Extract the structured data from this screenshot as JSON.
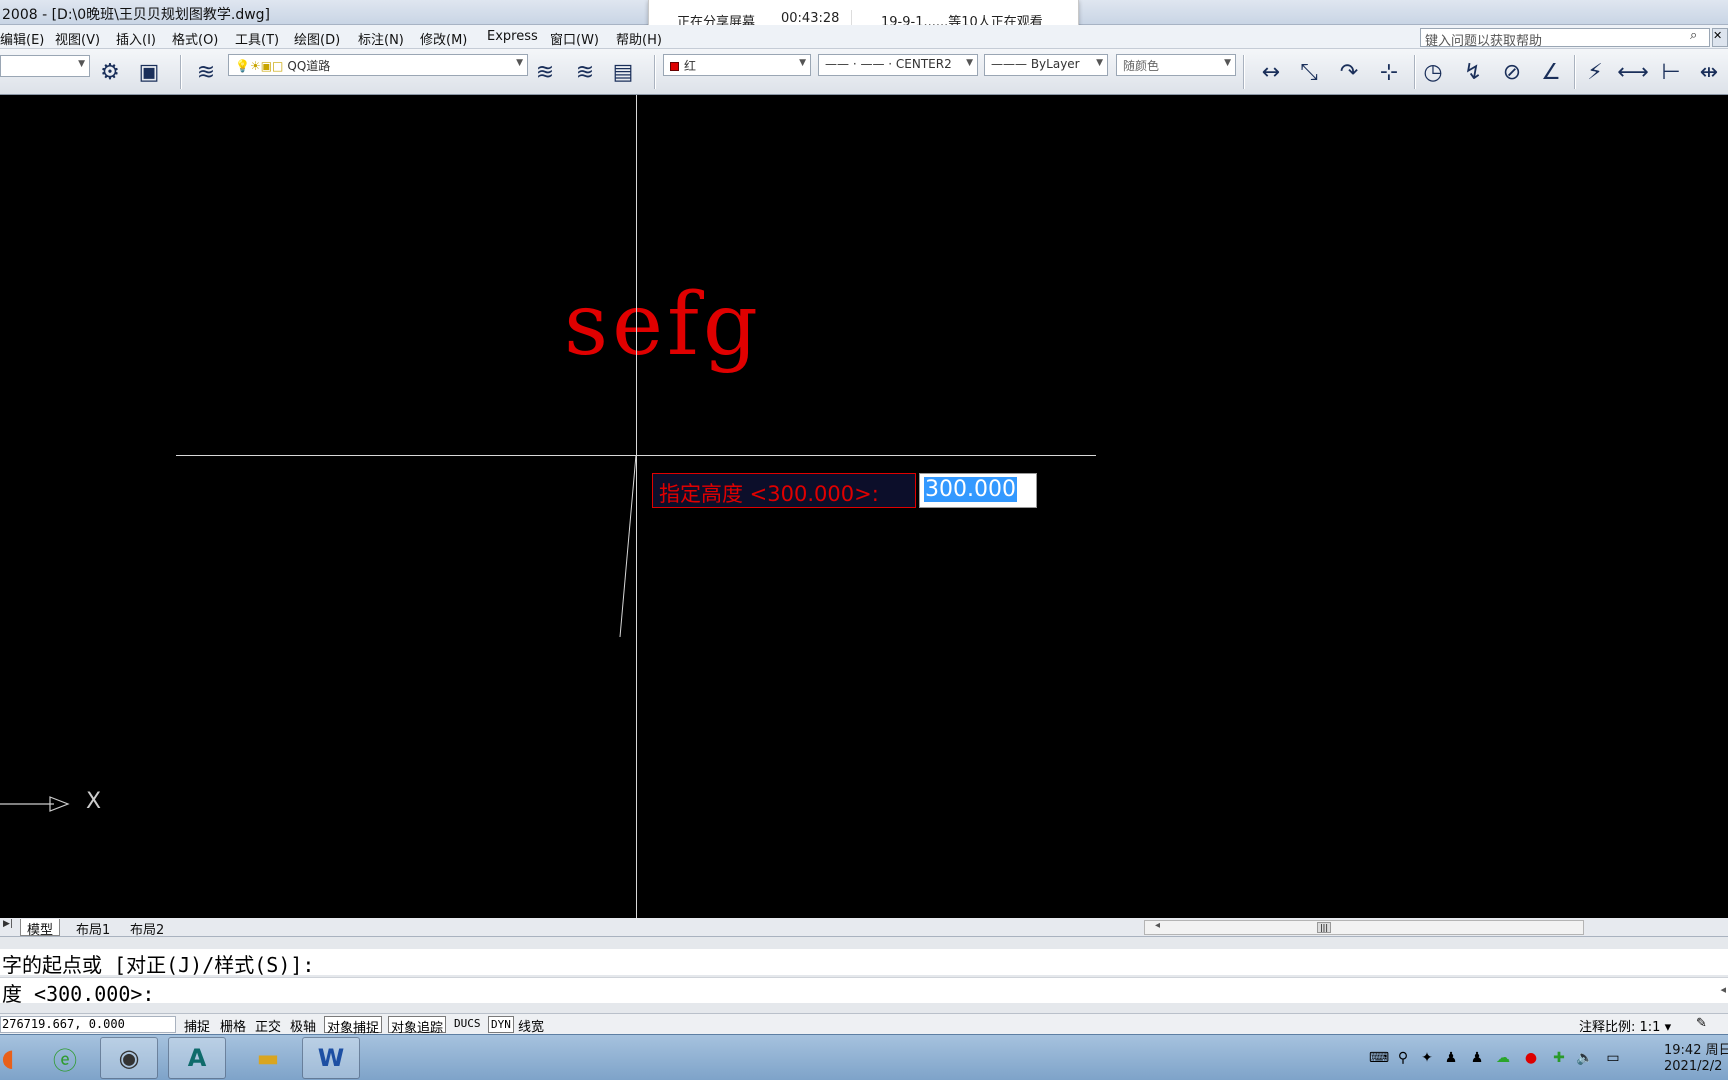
{
  "titlebar": {
    "title": "2008 - [D:\\0晚班\\王贝贝规划图教学.dwg]"
  },
  "share_banner": {
    "status": "正在分享屏幕",
    "timer": "00:43:28",
    "viewers": "19-9-1......等10人正在观看"
  },
  "menu": [
    {
      "label": "编辑(E)"
    },
    {
      "label": "视图(V)"
    },
    {
      "label": "插入(I)"
    },
    {
      "label": "格式(O)"
    },
    {
      "label": "工具(T)"
    },
    {
      "label": "绘图(D)"
    },
    {
      "label": "标注(N)"
    },
    {
      "label": "修改(M)"
    },
    {
      "label": "Express"
    },
    {
      "label": "窗口(W)"
    },
    {
      "label": "帮助(H)"
    }
  ],
  "help_search": {
    "placeholder": "键入问题以获取帮助"
  },
  "toolbar": {
    "layer": "QQ道路",
    "color": "红",
    "linetype": "CENTER2",
    "lineweight": "ByLayer",
    "plotstyle": "随颜色",
    "color_swatch": "#dd0000"
  },
  "canvas": {
    "text_entity": "sefg",
    "prompt": "指定高度 <300.000>:",
    "input_value": "300.000",
    "ucs_axis": "X",
    "entity_color": "#e00000"
  },
  "tabs": [
    {
      "label": "模型"
    },
    {
      "label": "布局1"
    },
    {
      "label": "布局2"
    }
  ],
  "command": {
    "line1": "字的起点或 [对正(J)/样式(S)]:",
    "line2": "度 <300.000>:"
  },
  "status": {
    "coords": "276719.667, 0.000",
    "buttons": [
      {
        "label": "捕捉"
      },
      {
        "label": "栅格"
      },
      {
        "label": "正交"
      },
      {
        "label": "极轴"
      },
      {
        "label": "对象捕捉"
      },
      {
        "label": "对象追踪"
      },
      {
        "label": "DUCS"
      },
      {
        "label": "DYN"
      },
      {
        "label": "线宽"
      }
    ],
    "annotation_scale": "注释比例: 1:1"
  },
  "taskbar": {
    "time": "19:42 周日",
    "date": "2021/2/2"
  }
}
